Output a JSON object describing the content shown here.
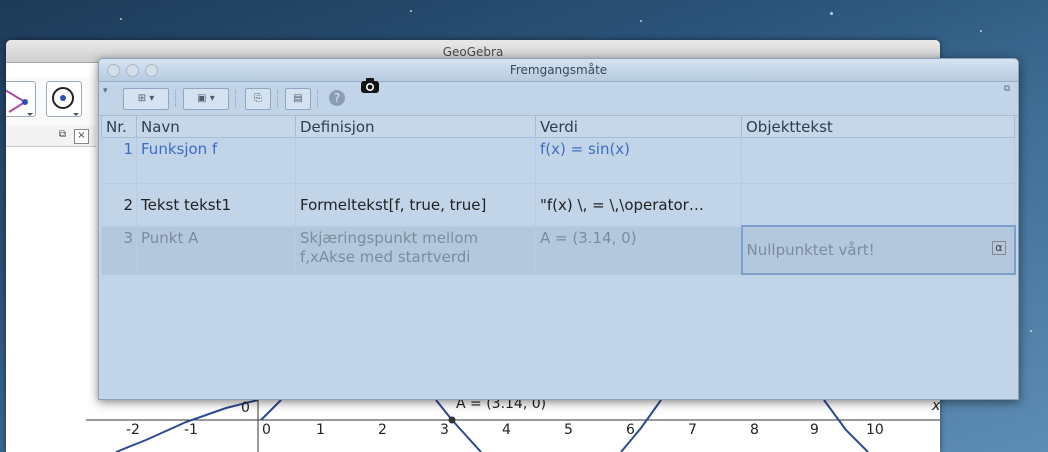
{
  "background_window": {
    "title": "GeoGebra",
    "close_label": "×",
    "x_axis_label": "x",
    "ticks": [
      "-2",
      "-1",
      "0",
      "1",
      "2",
      "3",
      "4",
      "5",
      "6",
      "7",
      "8",
      "9",
      "10"
    ],
    "origin_label": "0",
    "graph_point_label": "A = (3.14, 0)"
  },
  "protocol_window": {
    "title": "Fremgangsmåte",
    "columns": [
      "Nr.",
      "Navn",
      "Definisjon",
      "Verdi",
      "Objekttekst"
    ],
    "rows": [
      {
        "nr": "1",
        "name": "Funksjon f",
        "definition": "",
        "value": "f(x) = sin(x)",
        "caption": ""
      },
      {
        "nr": "2",
        "name": "Tekst tekst1",
        "definition": "Formeltekst[f, true, true]",
        "value": "\"f(x) \\, = \\,\\operator…",
        "caption": ""
      },
      {
        "nr": "3",
        "name": "Punkt A",
        "definition_line1": "Skjæringspunkt mellom",
        "definition_line2": "f,xAkse med startverdi",
        "value": "A = (3.14, 0)",
        "caption": "Nullpunktet vårt!",
        "caption_button": "α"
      }
    ]
  }
}
